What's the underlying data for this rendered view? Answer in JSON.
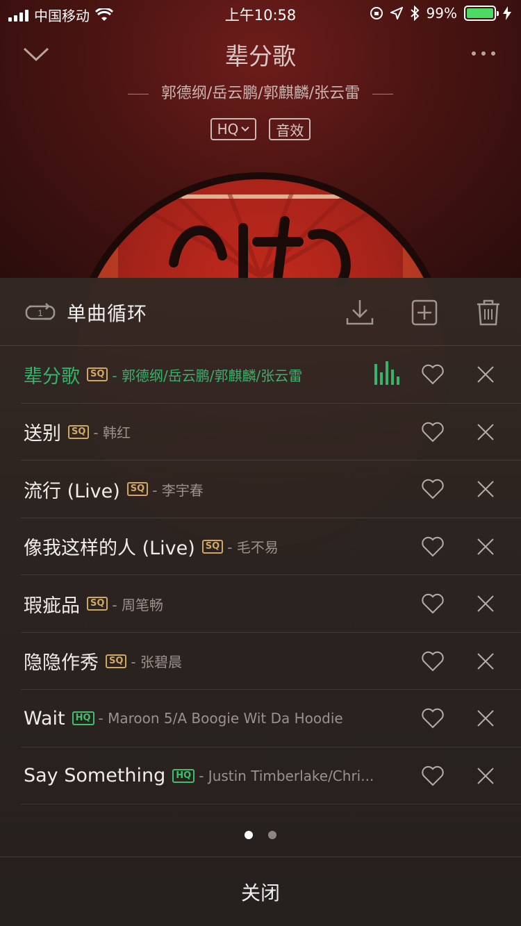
{
  "status_bar": {
    "carrier": "中国移动",
    "time": "上午10:58",
    "battery": "99%",
    "battery_level": 0.99
  },
  "now_playing": {
    "title": "辈分歌",
    "artist": "郭德纲/岳云鹏/郭麒麟/张云雷",
    "quality_tag": "HQ",
    "effects_tag": "音效",
    "icons": [
      "chevron-down-icon",
      "more-icon"
    ]
  },
  "playlist": {
    "mode_label": "单曲循环",
    "mode_icon": "repeat-one-icon",
    "toolbar_icons": [
      "download-icon",
      "add-to-playlist-icon",
      "trash-icon"
    ],
    "items": [
      {
        "name": "辈分歌",
        "quality": "SQ",
        "artist": "- 郭德纲/岳云鹏/郭麒麟/张云雷",
        "playing": true
      },
      {
        "name": "送别",
        "quality": "SQ",
        "artist": "- 韩红",
        "playing": false
      },
      {
        "name": "流行 (Live)",
        "quality": "SQ",
        "artist": "- 李宇春",
        "playing": false
      },
      {
        "name": "像我这样的人 (Live)",
        "quality": "SQ",
        "artist": "- 毛不易",
        "playing": false
      },
      {
        "name": "瑕疵品",
        "quality": "SQ",
        "artist": "- 周笔畅",
        "playing": false
      },
      {
        "name": "隐隐作秀",
        "quality": "SQ",
        "artist": "- 张碧晨",
        "playing": false
      },
      {
        "name": "Wait",
        "quality": "HQ",
        "artist": "- Maroon 5/A Boogie Wit Da Hoodie",
        "playing": false
      },
      {
        "name": "Say Something",
        "quality": "HQ",
        "artist": "- Justin Timberlake/Chri...",
        "playing": false
      }
    ],
    "page_count": 2,
    "current_page": 1,
    "close_label": "关闭"
  },
  "colors": {
    "accent_green": "#34b56a",
    "sq_gold": "#d1a764",
    "hq_green": "#3fbf6e",
    "player_red": "#6e1d1a"
  }
}
